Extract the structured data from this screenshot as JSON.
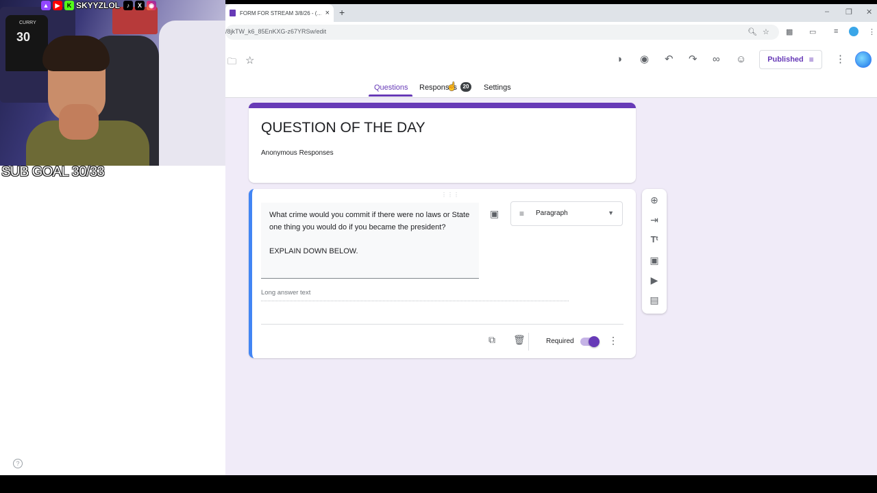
{
  "browser": {
    "tab_title": "FORM FOR STREAM 3/8/26 - (…",
    "tab_close": "×",
    "new_tab": "+",
    "url": "/8jkTW_k6_85EnKXG-z67YRSw/edit",
    "window_controls": [
      "–",
      "❐",
      "✕"
    ]
  },
  "forms": {
    "published_label": "Published",
    "tabs": [
      {
        "label": "Questions",
        "active": true
      },
      {
        "label": "Responses"
      },
      {
        "label": "Settings"
      }
    ],
    "responses_count": "20",
    "accent_color": "#673ab7"
  },
  "title_card": {
    "title": "QUESTION OF THE DAY",
    "description": "Anonymous Responses"
  },
  "question": {
    "text": "What crime would you commit if there were no laws or State one thing you would do if you became the president?\n\nEXPLAIN DOWN BELOW.",
    "type": "Paragraph",
    "answer_placeholder": "Long answer text",
    "required_label": "Required",
    "required": true
  },
  "stream_overlay": {
    "handle": "SKYYZLOL",
    "sub_goal": "SUB GOAL 30/33",
    "jersey_name": "CURRY",
    "jersey_number": "30"
  },
  "icons": [
    "folder-icon",
    "star-icon",
    "palette-icon",
    "preview-icon",
    "undo-icon",
    "redo-icon",
    "link-icon",
    "add-collaborator-icon",
    "more-vert-icon",
    "add-question-icon",
    "import-questions-icon",
    "add-title-icon",
    "add-image-icon",
    "add-video-icon",
    "add-section-icon",
    "duplicate-icon",
    "delete-icon",
    "help-icon"
  ]
}
